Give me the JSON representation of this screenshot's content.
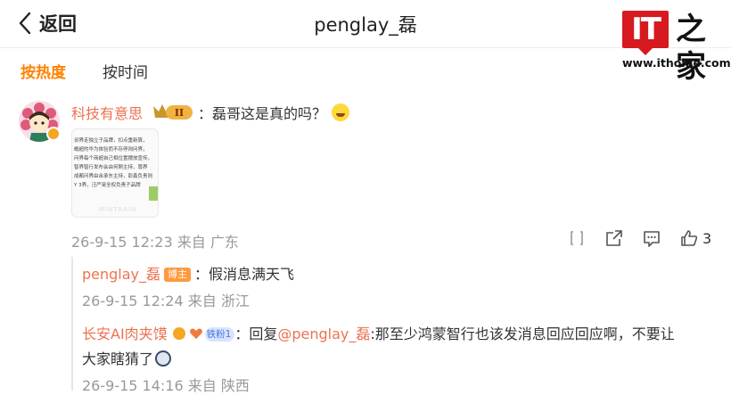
{
  "header": {
    "back_label": "返回",
    "title": "penglay_磊"
  },
  "logo": {
    "it": "IT",
    "zh": "之家",
    "url": "www.ithome.com"
  },
  "tabs": [
    {
      "label": "按热度",
      "active": true
    },
    {
      "label": "按时间",
      "active": false
    }
  ],
  "comment": {
    "author": "科技有意思",
    "level_badge": "II",
    "text": "：磊哥这是真的吗？",
    "meta": "26-9-15 12:23 来自 广东",
    "like_count": "3",
    "image_text": [
      "训界走独立子品牌，扣点重新算，",
      "概超的华为体验而不存停则问界，",
      "问界每个商超自己相位置摆放宣传，",
      "智界智行发布会由何刚主持，尊界",
      "成都问界由余承东主持，彭鑫负责则",
      "Y 3界，汪严旻全权负责子品牌"
    ],
    "image_watermark": "MINTRAIN"
  },
  "replies": [
    {
      "author": "penglay_磊",
      "tag": "博主",
      "text": "：假消息满天飞",
      "meta": "26-9-15 12:24 来自 浙江"
    },
    {
      "author": "长安AI肉夹馍",
      "tag": "铁粉1",
      "prefix": "：回复",
      "mention": "@penglay_磊",
      "text": ":那至少鸿蒙智行也该发消息回应回应啊，不要让",
      "text2": "大家瞎猜了",
      "meta": "26-9-15 14:16 来自 陕西"
    }
  ],
  "colors": {
    "accent_orange": "#ff8200",
    "name_color": "#eb7350",
    "meta_gray": "#999999",
    "logo_red": "#d71920"
  }
}
